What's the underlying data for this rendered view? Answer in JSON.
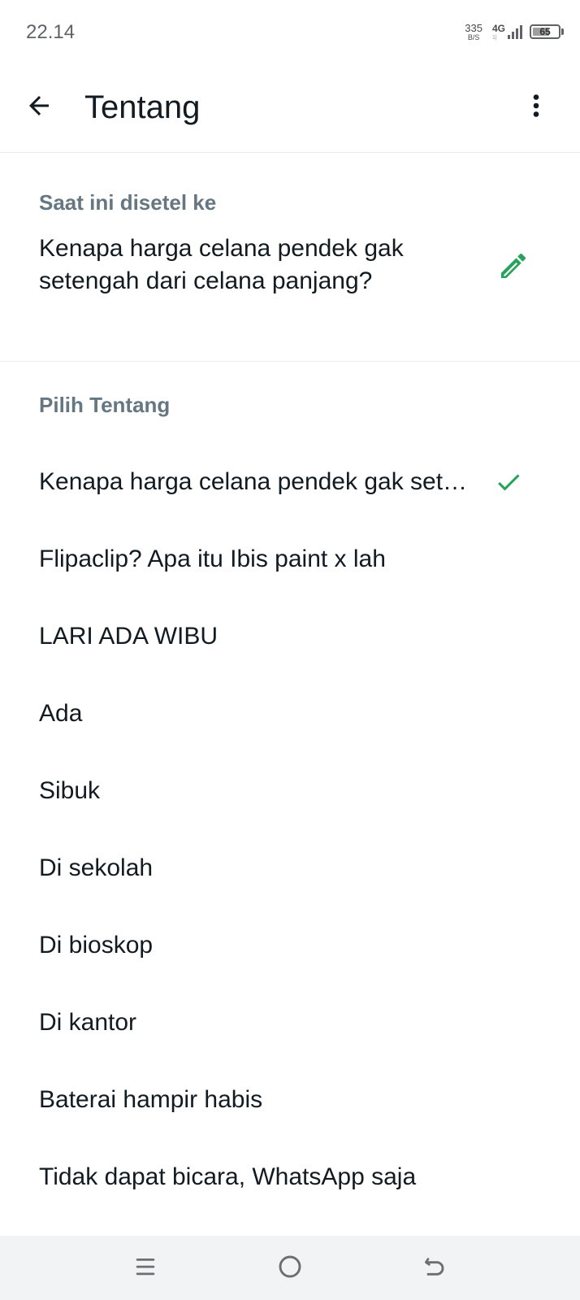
{
  "status_bar": {
    "time": "22.14",
    "net_speed_value": "335",
    "net_speed_unit": "B/S",
    "network_type": "4G",
    "network_sub": "1|",
    "battery_level": "65",
    "battery_fraction": 0.65
  },
  "app_bar": {
    "title": "Tentang",
    "back_icon": "arrow-back-icon",
    "menu_icon": "more-vert-icon"
  },
  "current": {
    "header": "Saat ini disetel ke",
    "text": "Kenapa harga celana pendek gak setengah dari celana panjang?",
    "edit_icon": "pencil-icon"
  },
  "options": {
    "header": "Pilih Tentang",
    "items": [
      {
        "label": "Kenapa harga celana pendek gak set…",
        "selected": true
      },
      {
        "label": "Flipaclip? Apa itu Ibis paint x lah",
        "selected": false
      },
      {
        "label": "LARI ADA WIBU",
        "selected": false
      },
      {
        "label": "Ada",
        "selected": false
      },
      {
        "label": "Sibuk",
        "selected": false
      },
      {
        "label": "Di sekolah",
        "selected": false
      },
      {
        "label": "Di bioskop",
        "selected": false
      },
      {
        "label": "Di kantor",
        "selected": false
      },
      {
        "label": "Baterai hampir habis",
        "selected": false
      },
      {
        "label": "Tidak dapat bicara, WhatsApp saja",
        "selected": false
      }
    ]
  },
  "nav_bar": {
    "recents_icon": "menu-lines-icon",
    "home_icon": "home-circle-icon",
    "back_icon": "back-gesture-icon"
  },
  "colors": {
    "accent": "#25a35a",
    "header_text": "#667781",
    "primary_text": "#111b21"
  }
}
